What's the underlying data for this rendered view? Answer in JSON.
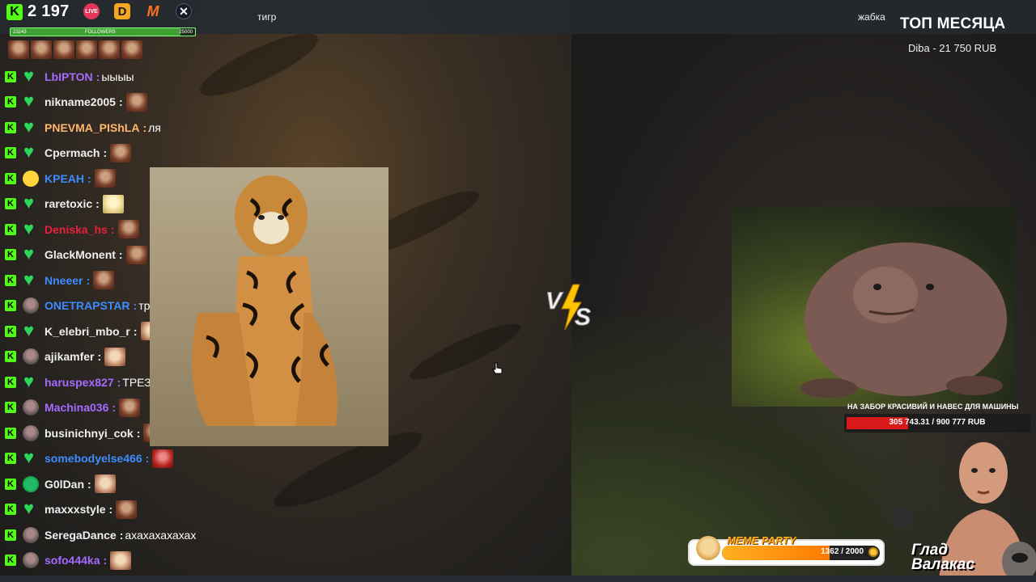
{
  "stats": {
    "followers_count": "2 197"
  },
  "followers_bar": {
    "left": "23243",
    "label": "FOLLOWERS",
    "right": "25000",
    "progress": 0.92
  },
  "platforms": [
    {
      "name": "live-icon",
      "glyph": "LIVE"
    },
    {
      "name": "donationalerts-icon",
      "glyph": "D"
    },
    {
      "name": "memealerts-icon",
      "glyph": "M"
    },
    {
      "name": "x-icon",
      "glyph": "✕"
    }
  ],
  "labels": {
    "left_title": "тигр",
    "right_title": "жабка"
  },
  "top_month": {
    "title": "ТОП МЕСЯЦА",
    "donor": "Diba - 21 750 RUB"
  },
  "chat": {
    "top_emote_count": 6,
    "messages": [
      {
        "user": "LbIPTON",
        "color": "#a46bff",
        "text": "ыыыы",
        "emote": "",
        "avatar": "heart"
      },
      {
        "user": "nikname2005",
        "color": "#f0f0f0",
        "text": "",
        "emote": "face",
        "avatar": "heart"
      },
      {
        "user": "PNEVMA_PIShLA",
        "color": "#ffb86b",
        "text": "ля",
        "emote": "",
        "avatar": "heart"
      },
      {
        "user": "Cpermach",
        "color": "#f0f0f0",
        "text": "",
        "emote": "face",
        "avatar": "heart"
      },
      {
        "user": "KPEAH",
        "color": "#3d8cff",
        "text": "",
        "emote": "face",
        "avatar": "sun"
      },
      {
        "user": "raretoxic",
        "color": "#f0f0f0",
        "text": "",
        "emote": "anime",
        "avatar": "heart"
      },
      {
        "user": "Deniska_hs",
        "color": "#e8203a",
        "text": "",
        "emote": "face",
        "avatar": "heart"
      },
      {
        "user": "GlackMonent",
        "color": "#f0f0f0",
        "text": "",
        "emote": "face",
        "avatar": "heart"
      },
      {
        "user": "Nneeer",
        "color": "#3d8cff",
        "text": "",
        "emote": "face",
        "avatar": "heart"
      },
      {
        "user": "ONETRAPSTAR",
        "color": "#3d8cff",
        "text": "трецубец",
        "emote": "",
        "avatar": "photo"
      },
      {
        "user": "K_elebri_mbo_r",
        "color": "#f0f0f0",
        "text": "",
        "emote": "face2",
        "avatar": "heart"
      },
      {
        "user": "ajikamfer",
        "color": "#f0f0f0",
        "text": "",
        "emote": "face2",
        "avatar": "photo"
      },
      {
        "user": "haruspex827",
        "color": "#a46bff",
        "text": "ТРЕЗУБ",
        "emote": "",
        "avatar": "heart"
      },
      {
        "user": "Machina036",
        "color": "#a46bff",
        "text": "",
        "emote": "face",
        "avatar": "photo"
      },
      {
        "user": "businichnyi_cok",
        "color": "#f0f0f0",
        "text": "",
        "emote": "face",
        "avatar": "photo"
      },
      {
        "user": "somebodyelse466",
        "color": "#3d8cff",
        "text": "",
        "emote": "red",
        "avatar": "heart"
      },
      {
        "user": "G0lDan",
        "color": "#f0f0f0",
        "text": "",
        "emote": "face2",
        "avatar": "ring"
      },
      {
        "user": "maxxxstyle",
        "color": "#f0f0f0",
        "text": "",
        "emote": "face",
        "avatar": "heart"
      },
      {
        "user": "SeregaDance",
        "color": "#f0f0f0",
        "text": "ахахахахахах",
        "emote": "",
        "avatar": "photo"
      },
      {
        "user": "sofo444ka",
        "color": "#a46bff",
        "text": "",
        "emote": "face2",
        "avatar": "photo"
      }
    ]
  },
  "goal": {
    "title": "НА ЗАБОР КРАСИВИЙ И НАВЕС ДЛЯ МАШИНЫ",
    "current": 305743.31,
    "target": 900777,
    "text": "305 743.31 / 900 777 RUB"
  },
  "meme_party": {
    "title": "MEME PARTY",
    "current": 1362,
    "target": 2000,
    "text": "1362 / 2000"
  },
  "streamer_name": {
    "line1": "Глад",
    "line2": "Валакас"
  },
  "colors": {
    "kick_green": "#53fc18",
    "goal_red": "#d91a1a",
    "meme_orange": "#ff8c00"
  }
}
